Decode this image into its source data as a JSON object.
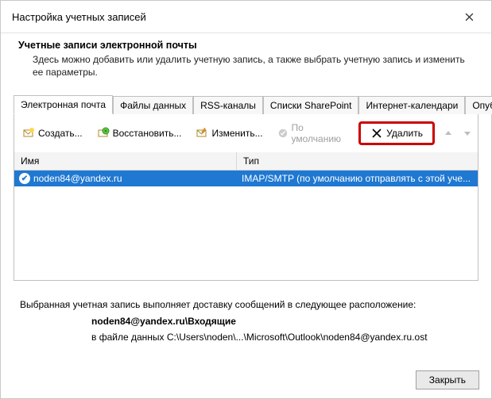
{
  "window": {
    "title": "Настройка учетных записей"
  },
  "intro": {
    "heading": "Учетные записи электронной почты",
    "subtext": "Здесь можно добавить или удалить учетную запись, а также выбрать учетную запись и изменить ее параметры."
  },
  "tabs": {
    "items": [
      {
        "label": "Электронная почта"
      },
      {
        "label": "Файлы данных"
      },
      {
        "label": "RSS-каналы"
      },
      {
        "label": "Списки SharePoint"
      },
      {
        "label": "Интернет-календари"
      },
      {
        "label": "Опублико"
      }
    ]
  },
  "toolbar": {
    "create": "Создать...",
    "repair": "Восстановить...",
    "edit": "Изменить...",
    "default": "По умолчанию",
    "delete": "Удалить"
  },
  "table": {
    "headers": {
      "name": "Имя",
      "type": "Тип"
    },
    "rows": [
      {
        "name": "noden84@yandex.ru",
        "type": "IMAP/SMTP (по умолчанию отправлять с этой уче..."
      }
    ]
  },
  "delivery": {
    "line1": "Выбранная учетная запись выполняет доставку сообщений в следующее расположение:",
    "line2": "noden84@yandex.ru\\Входящие",
    "line3": "в файле данных C:\\Users\\noden\\...\\Microsoft\\Outlook\\noden84@yandex.ru.ost"
  },
  "footer": {
    "close": "Закрыть"
  }
}
